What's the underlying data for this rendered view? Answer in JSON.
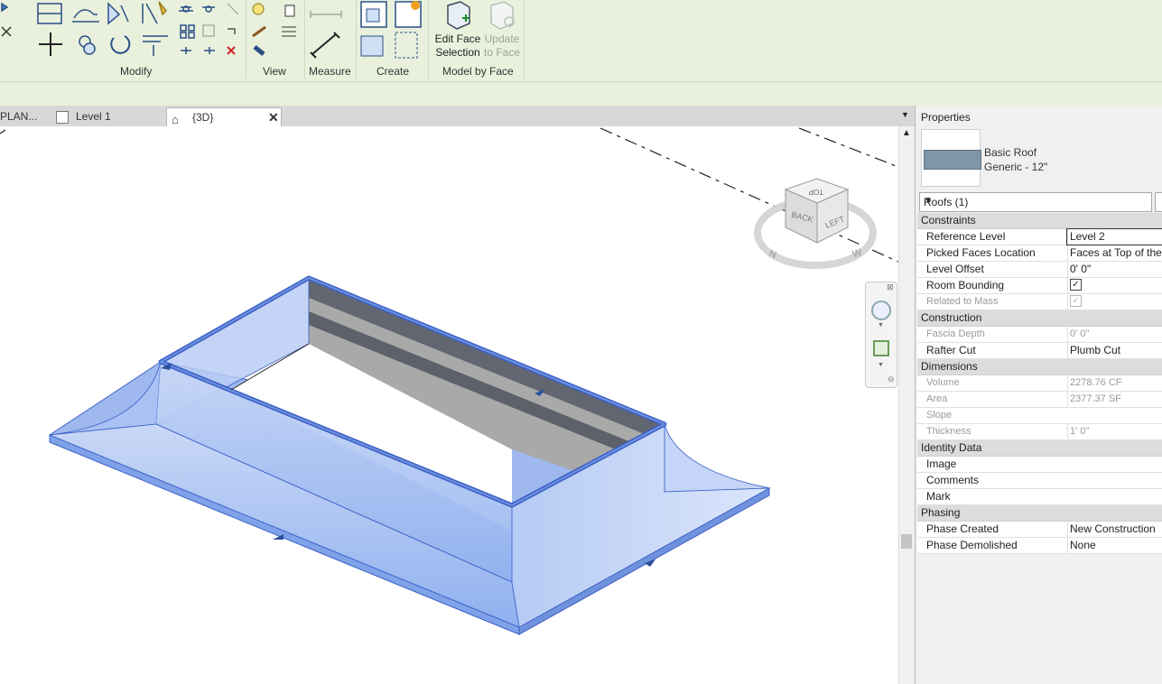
{
  "ribbon": {
    "panels": {
      "modify": "Modify",
      "view": "View",
      "measure": "Measure",
      "create": "Create",
      "model_by_face": "Model by Face"
    },
    "buttons": {
      "edit_face_selection": [
        "Edit Face",
        "Selection"
      ],
      "update_to_face": [
        "Update",
        "to Face"
      ]
    }
  },
  "tabs": [
    {
      "label": "PLAN..."
    },
    {
      "label": "Level 1"
    },
    {
      "label": "{3D}"
    }
  ],
  "viewcube": {
    "top": "TOP",
    "back": "BACK",
    "left": "LEFT",
    "n": "N",
    "w": "W"
  },
  "properties": {
    "title": "Properties",
    "type_name": "Basic Roof",
    "type_sub": "Generic - 12\"",
    "selector": "Roofs (1)",
    "groups": [
      {
        "name": "Constraints",
        "rows": [
          {
            "key": "Reference Level",
            "value": "Level 2",
            "editing": true
          },
          {
            "key": "Picked Faces Location",
            "value": "Faces at Top of the"
          },
          {
            "key": "Level Offset",
            "value": "0'  0\""
          },
          {
            "key": "Room Bounding",
            "check": true
          },
          {
            "key": "Related to Mass",
            "check": true,
            "disabled": true
          }
        ]
      },
      {
        "name": "Construction",
        "rows": [
          {
            "key": "Fascia Depth",
            "value": "0'  0\"",
            "disabled": true
          },
          {
            "key": "Rafter Cut",
            "value": "Plumb Cut"
          }
        ]
      },
      {
        "name": "Dimensions",
        "rows": [
          {
            "key": "Volume",
            "value": "2278.76 CF",
            "disabled": true
          },
          {
            "key": "Area",
            "value": "2377.37 SF",
            "disabled": true
          },
          {
            "key": "Slope",
            "value": "",
            "disabled": true
          },
          {
            "key": "Thickness",
            "value": "1'  0\"",
            "disabled": true
          }
        ]
      },
      {
        "name": "Identity Data",
        "rows": [
          {
            "key": "Image",
            "value": ""
          },
          {
            "key": "Comments",
            "value": ""
          },
          {
            "key": "Mark",
            "value": ""
          }
        ]
      },
      {
        "name": "Phasing",
        "rows": [
          {
            "key": "Phase Created",
            "value": "New Construction"
          },
          {
            "key": "Phase Demolished",
            "value": "None"
          }
        ]
      }
    ]
  },
  "colors": {
    "ribbon": "#e9f1dd",
    "roof_blue": "#7fa2e8",
    "roof_edge": "#3a5fc8",
    "swatch": "#7f95a8"
  }
}
